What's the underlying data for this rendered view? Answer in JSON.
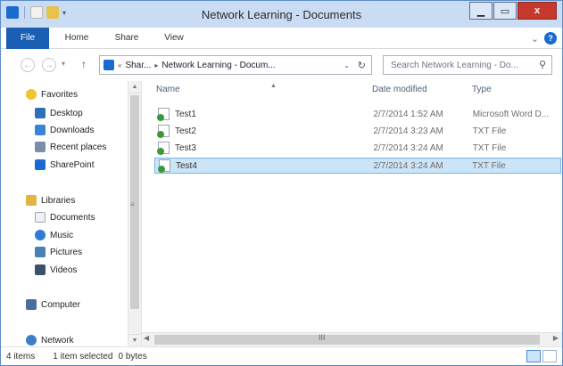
{
  "window": {
    "title": "Network Learning - Documents",
    "min_label": "▁",
    "max_label": "▭",
    "close_label": "x"
  },
  "ribbon": {
    "tabs": [
      "File",
      "Home",
      "Share",
      "View"
    ],
    "expand_glyph": "⌄",
    "help_glyph": "?"
  },
  "address": {
    "path": [
      "Shar...",
      "Network Learning - Docum..."
    ],
    "dropdown_glyph": "⌄",
    "refresh_glyph": "↻"
  },
  "search": {
    "placeholder": "Search Network Learning - Do..."
  },
  "nav": {
    "favorites": "Favorites",
    "desktop": "Desktop",
    "downloads": "Downloads",
    "recent": "Recent places",
    "sharepoint": "SharePoint",
    "libraries": "Libraries",
    "documents": "Documents",
    "music": "Music",
    "pictures": "Pictures",
    "videos": "Videos",
    "computer": "Computer",
    "network": "Network"
  },
  "columns": {
    "name": "Name",
    "date": "Date modified",
    "type": "Type"
  },
  "files": [
    {
      "name": "Test1",
      "date": "2/7/2014 1:52 AM",
      "type": "Microsoft Word D...",
      "selected": false
    },
    {
      "name": "Test2",
      "date": "2/7/2014 3:23 AM",
      "type": "TXT File",
      "selected": false
    },
    {
      "name": "Test3",
      "date": "2/7/2014 3:24 AM",
      "type": "TXT File",
      "selected": false
    },
    {
      "name": "Test4",
      "date": "2/7/2014 3:24 AM",
      "type": "TXT File",
      "selected": true
    }
  ],
  "status": {
    "items": "4 items",
    "selected": "1 item selected",
    "size": "0 bytes"
  },
  "colors": {
    "file_tab": "#1a5fb4",
    "selection": "#cce4f7",
    "close": "#c7382d"
  }
}
